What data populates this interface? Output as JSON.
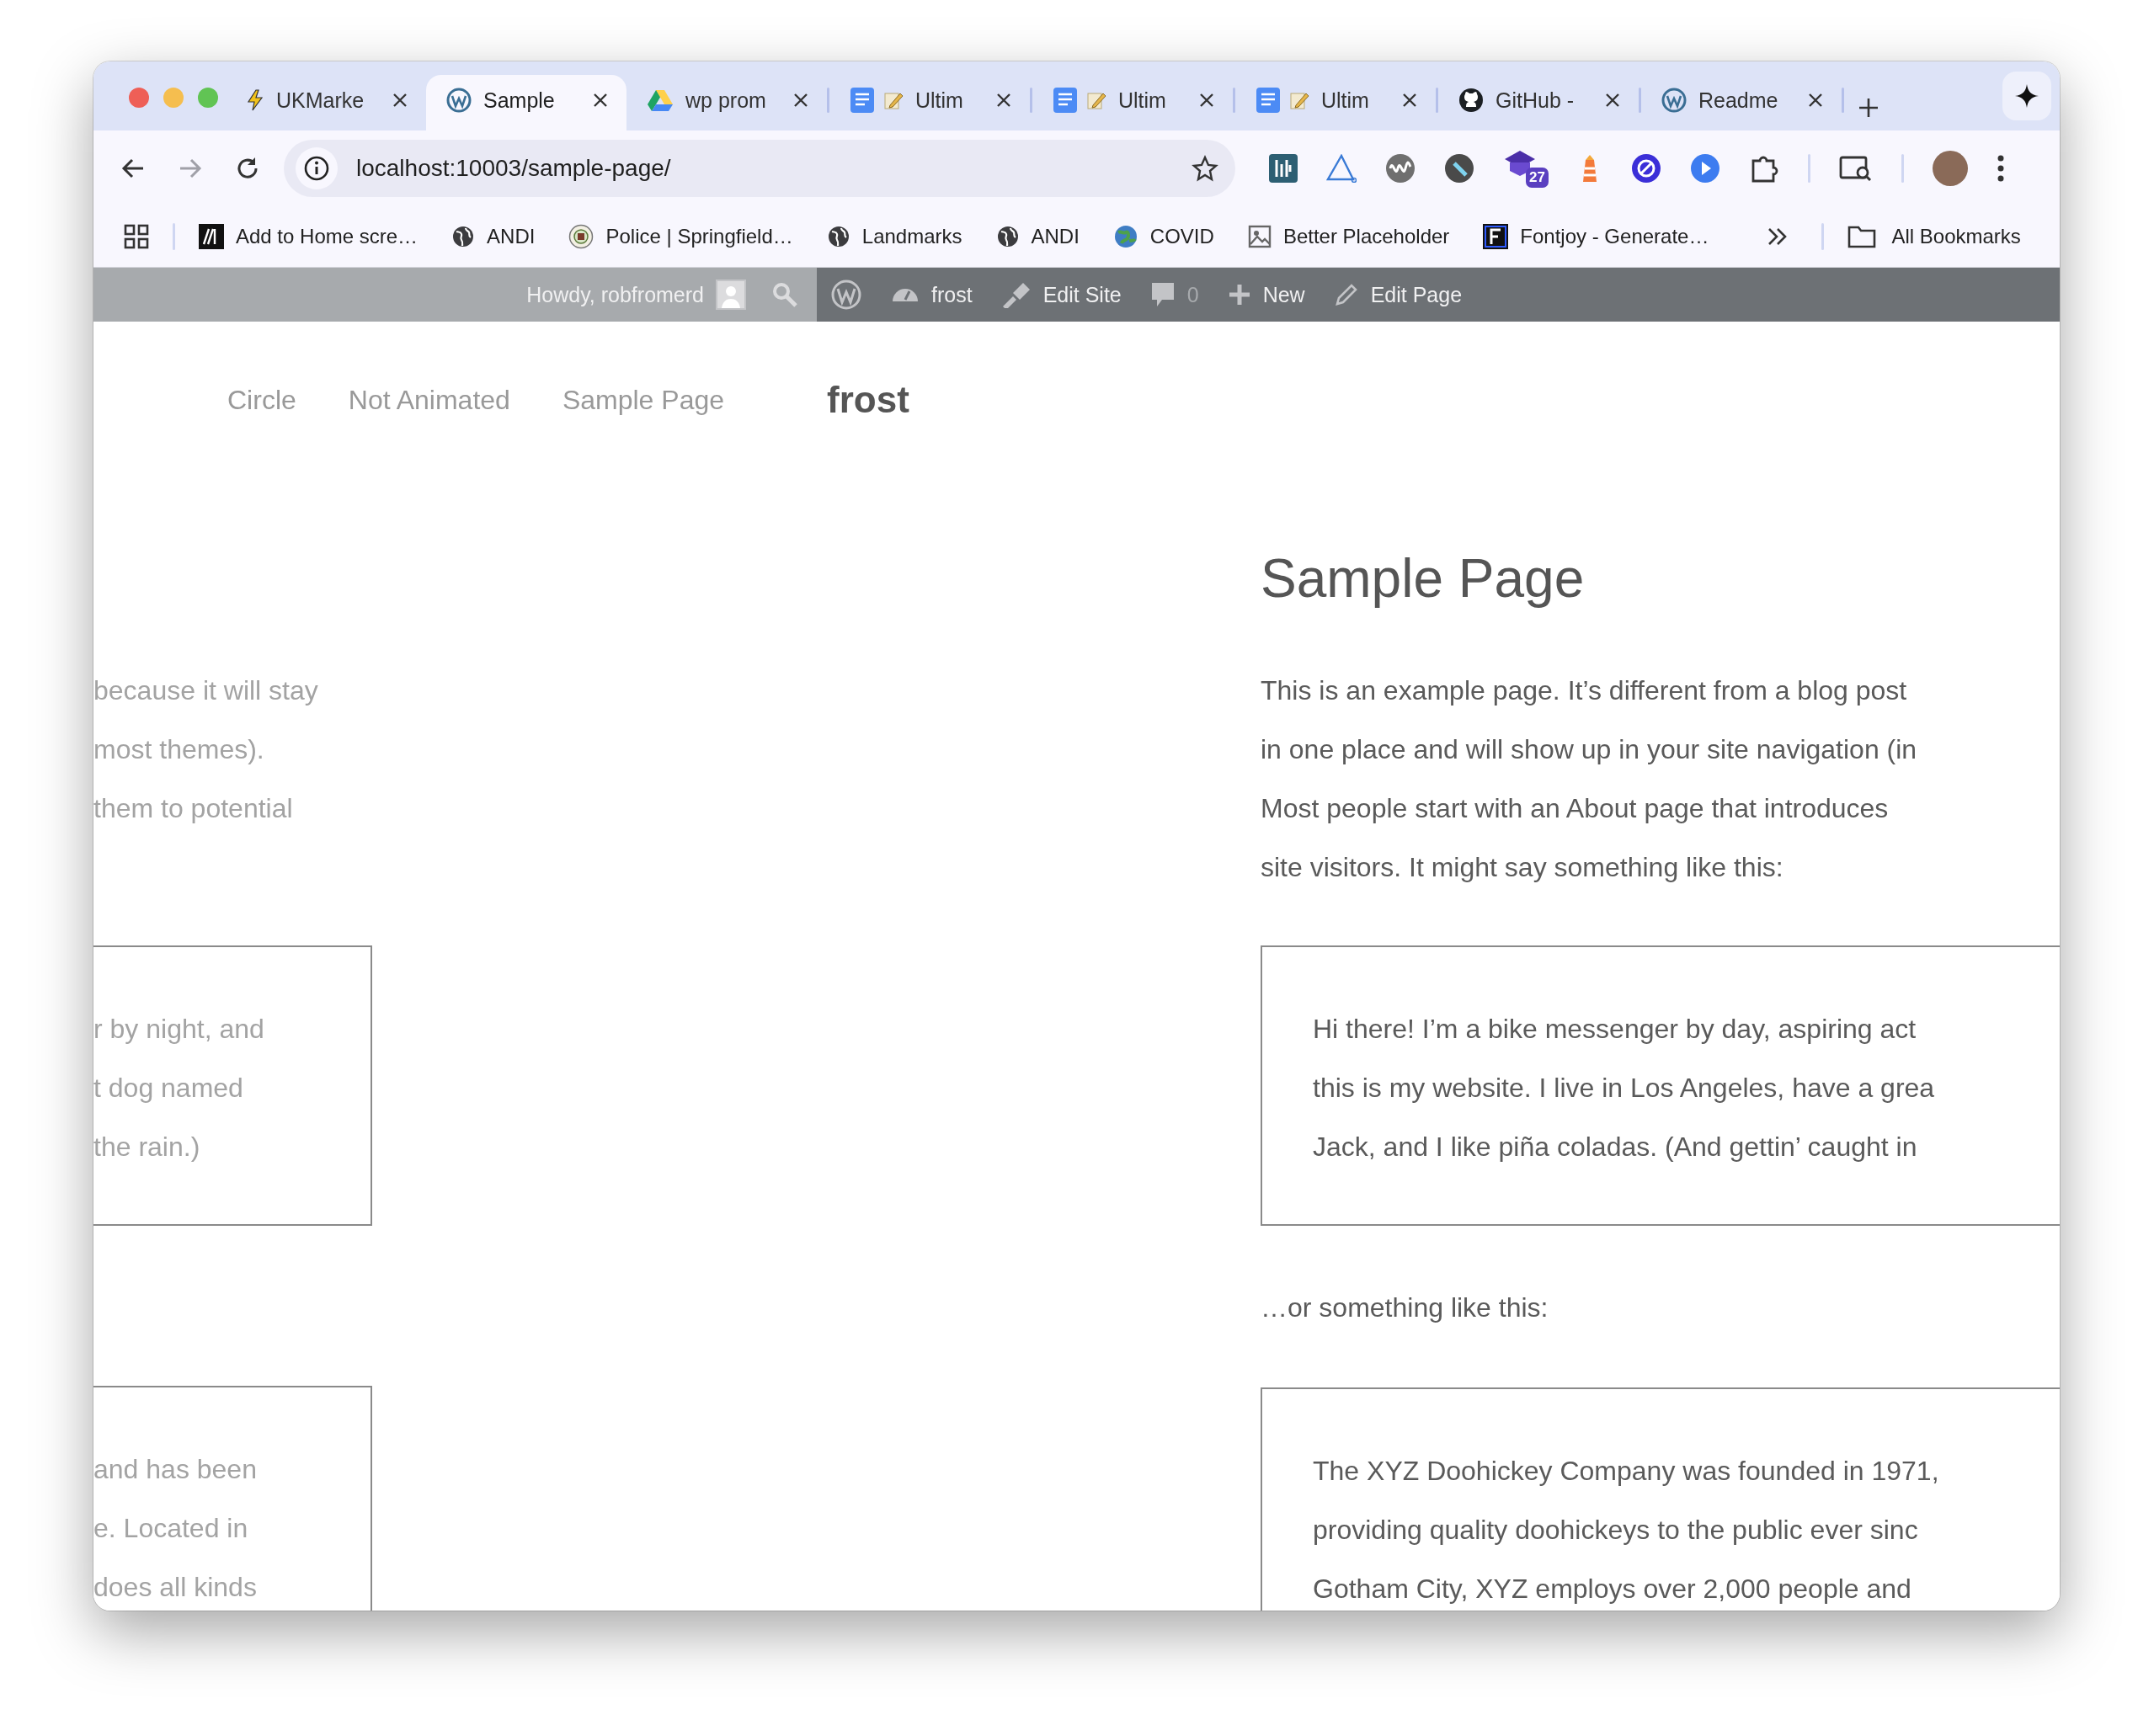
{
  "browser": {
    "tabs": [
      {
        "title": "UKMarke",
        "kind": "lightning",
        "selected": false
      },
      {
        "title": "Sample",
        "kind": "wordpress",
        "selected": true
      },
      {
        "title": "wp prom",
        "kind": "drive",
        "selected": false
      },
      {
        "title": "Ultim",
        "kind": "docs",
        "selected": false
      },
      {
        "title": "Ultim",
        "kind": "docs",
        "selected": false
      },
      {
        "title": "Ultim",
        "kind": "docs",
        "selected": false
      },
      {
        "title": "GitHub -",
        "kind": "github",
        "selected": false
      },
      {
        "title": "Readme",
        "kind": "wordpress",
        "selected": false
      }
    ],
    "forward_disabled": true,
    "address": "localhost:10003/sample-page/",
    "extension_badge": "27",
    "bookmarks": [
      {
        "label": "Add to Home scre…",
        "kind": "m-logo"
      },
      {
        "label": "ANDI",
        "kind": "globe"
      },
      {
        "label": "Police | Springfield…",
        "kind": "seal"
      },
      {
        "label": "Landmarks",
        "kind": "globe"
      },
      {
        "label": "ANDI",
        "kind": "globe"
      },
      {
        "label": "COVID",
        "kind": "earth"
      },
      {
        "label": "Better Placeholder",
        "kind": "image"
      },
      {
        "label": "Fontjoy - Generate…",
        "kind": "f-logo"
      }
    ],
    "all_bookmarks": "All Bookmarks"
  },
  "admin_bar": {
    "greeting": "Howdy, robfromerd",
    "site": "frost",
    "edit_site": "Edit Site",
    "comments": "0",
    "new": "New",
    "edit_page": "Edit Page"
  },
  "nav": {
    "items": [
      "Circle",
      "Not Animated",
      "Sample Page"
    ],
    "site_title": "frost"
  },
  "content": {
    "title": "Sample Page",
    "intro_lines": [
      "This is an example page. It’s different from a blog post",
      "in one place and will show up in your site navigation (in",
      "Most people start with an About page that introduces",
      "site visitors. It might say something like this:"
    ],
    "quote_1_lines": [
      "Hi there! I’m a bike messenger by day, aspiring act",
      "this is my website. I live in Los Angeles, have a grea",
      "Jack, and I like piña coladas. (And gettin’ caught in"
    ],
    "transition": "…or something like this:",
    "quote_2_lines": [
      "The XYZ Doohickey Company was founded in 1971,",
      "providing quality doohickeys to the public ever sinc",
      "Gotham City, XYZ employs over 2,000 people and"
    ]
  },
  "ghost": {
    "intro_lines": [
      "because it will stay",
      "most themes).",
      "them to potential"
    ],
    "quote_1_lines": [
      "r by night, and",
      "t dog named",
      "the rain.)"
    ],
    "quote_2_lines": [
      "and has been",
      "e. Located in",
      "does all kinds"
    ]
  }
}
